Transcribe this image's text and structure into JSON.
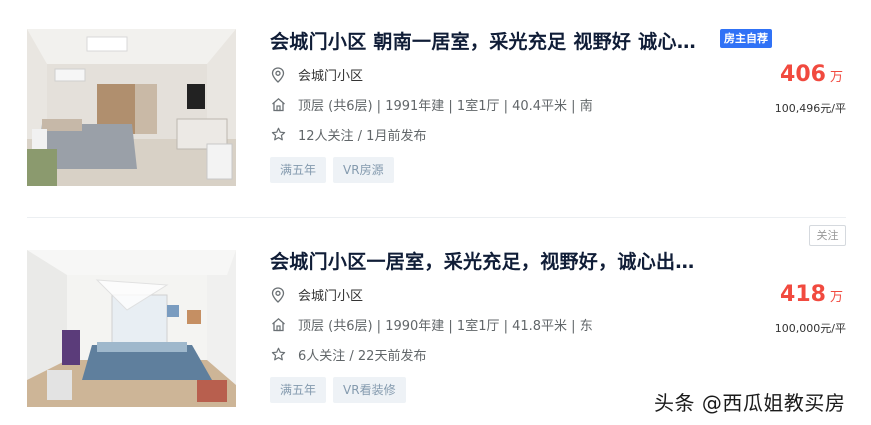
{
  "listings": [
    {
      "title": "会城门小区 朝南一居室，采光充足 视野好 诚心…",
      "badge": "房主自荐",
      "community": "会城门小区",
      "house_info": "顶层 (共6层) | 1991年建 | 1室1厅 | 40.4平米 | 南",
      "follow_info": "12人关注 / 1月前发布",
      "tags": [
        "满五年",
        "VR房源"
      ],
      "price": "406",
      "price_unit": "万",
      "unit_price": "100,496元/平",
      "icons": {
        "location": "location-pin-icon",
        "house": "house-icon",
        "star": "star-icon"
      }
    },
    {
      "title": "会城门小区一居室，采光充足，视野好，诚心出…",
      "follow_button": "关注",
      "community": "会城门小区",
      "house_info": "顶层 (共6层) | 1990年建 | 1室1厅 | 41.8平米 | 东",
      "follow_info": "6人关注 / 22天前发布",
      "tags": [
        "满五年",
        "VR看装修"
      ],
      "price": "418",
      "price_unit": "万",
      "unit_price": "100,000元/平",
      "icons": {
        "location": "location-pin-icon",
        "house": "house-icon",
        "star": "star-icon"
      }
    }
  ],
  "watermark": "头条 @西瓜姐教买房",
  "colors": {
    "price": "#f14a3f",
    "badge": "#3072f6",
    "title": "#101d37",
    "tag_bg": "#eef2f6",
    "tag_text": "#849aae"
  }
}
